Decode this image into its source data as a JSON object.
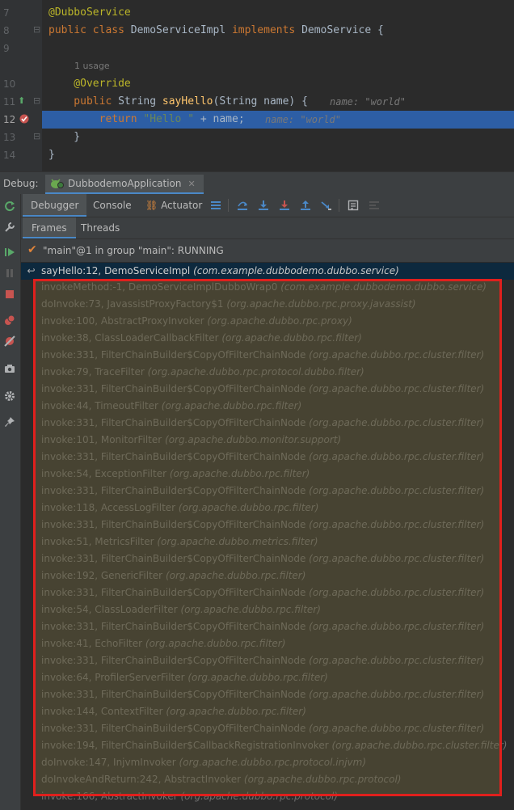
{
  "editor": {
    "lines": [
      {
        "num": "7",
        "segments": [
          {
            "cls": "ann",
            "text": "@DubboService"
          }
        ]
      },
      {
        "num": "8",
        "segments": [
          {
            "cls": "kw",
            "text": "public class "
          },
          {
            "cls": "",
            "text": "DemoServiceImpl "
          },
          {
            "cls": "kw",
            "text": "implements "
          },
          {
            "cls": "",
            "text": "DemoService {"
          }
        ]
      },
      {
        "num": "9",
        "segments": []
      },
      {
        "num": "",
        "usage": "1 usage",
        "segments": []
      },
      {
        "num": "10",
        "segments": [
          {
            "cls": "ann",
            "text": "    @Override"
          }
        ]
      },
      {
        "num": "11",
        "segments": [
          {
            "cls": "kw",
            "text": "    public "
          },
          {
            "cls": "",
            "text": "String "
          },
          {
            "cls": "fn",
            "text": "sayHello"
          },
          {
            "cls": "",
            "text": "(String name) {"
          }
        ],
        "hint": "name: \"world\""
      },
      {
        "num": "12",
        "current": true,
        "segments": [
          {
            "cls": "kw",
            "text": "        return "
          },
          {
            "cls": "str",
            "text": "\"Hello \" "
          },
          {
            "cls": "",
            "text": "+ name;"
          }
        ],
        "hint": "name: \"world\""
      },
      {
        "num": "13",
        "segments": [
          {
            "cls": "",
            "text": "    }"
          }
        ]
      },
      {
        "num": "14",
        "segments": [
          {
            "cls": "",
            "text": "}"
          }
        ]
      }
    ]
  },
  "debug": {
    "label": "Debug:",
    "run_tab": "DubbodemoApplication",
    "tabs": [
      "Debugger",
      "Console",
      "Actuator"
    ],
    "sub_tabs": [
      "Frames",
      "Threads"
    ],
    "thread_status": "\"main\"@1 in group \"main\": RUNNING"
  },
  "frames": [
    {
      "method": "sayHello:12, DemoServiceImpl ",
      "pkg": "(com.example.dubbodemo.dubbo.service)"
    },
    {
      "method": "invokeMethod:-1, DemoServiceImplDubboWrap0 ",
      "pkg": "(com.example.dubbodemo.dubbo.service)"
    },
    {
      "method": "doInvoke:73, JavassistProxyFactory$1 ",
      "pkg": "(org.apache.dubbo.rpc.proxy.javassist)"
    },
    {
      "method": "invoke:100, AbstractProxyInvoker ",
      "pkg": "(org.apache.dubbo.rpc.proxy)"
    },
    {
      "method": "invoke:38, ClassLoaderCallbackFilter ",
      "pkg": "(org.apache.dubbo.rpc.filter)"
    },
    {
      "method": "invoke:331, FilterChainBuilder$CopyOfFilterChainNode ",
      "pkg": "(org.apache.dubbo.rpc.cluster.filter)"
    },
    {
      "method": "invoke:79, TraceFilter ",
      "pkg": "(org.apache.dubbo.rpc.protocol.dubbo.filter)"
    },
    {
      "method": "invoke:331, FilterChainBuilder$CopyOfFilterChainNode ",
      "pkg": "(org.apache.dubbo.rpc.cluster.filter)"
    },
    {
      "method": "invoke:44, TimeoutFilter ",
      "pkg": "(org.apache.dubbo.rpc.filter)"
    },
    {
      "method": "invoke:331, FilterChainBuilder$CopyOfFilterChainNode ",
      "pkg": "(org.apache.dubbo.rpc.cluster.filter)"
    },
    {
      "method": "invoke:101, MonitorFilter ",
      "pkg": "(org.apache.dubbo.monitor.support)"
    },
    {
      "method": "invoke:331, FilterChainBuilder$CopyOfFilterChainNode ",
      "pkg": "(org.apache.dubbo.rpc.cluster.filter)"
    },
    {
      "method": "invoke:54, ExceptionFilter ",
      "pkg": "(org.apache.dubbo.rpc.filter)"
    },
    {
      "method": "invoke:331, FilterChainBuilder$CopyOfFilterChainNode ",
      "pkg": "(org.apache.dubbo.rpc.cluster.filter)"
    },
    {
      "method": "invoke:118, AccessLogFilter ",
      "pkg": "(org.apache.dubbo.rpc.filter)"
    },
    {
      "method": "invoke:331, FilterChainBuilder$CopyOfFilterChainNode ",
      "pkg": "(org.apache.dubbo.rpc.cluster.filter)"
    },
    {
      "method": "invoke:51, MetricsFilter ",
      "pkg": "(org.apache.dubbo.metrics.filter)"
    },
    {
      "method": "invoke:331, FilterChainBuilder$CopyOfFilterChainNode ",
      "pkg": "(org.apache.dubbo.rpc.cluster.filter)"
    },
    {
      "method": "invoke:192, GenericFilter ",
      "pkg": "(org.apache.dubbo.rpc.filter)"
    },
    {
      "method": "invoke:331, FilterChainBuilder$CopyOfFilterChainNode ",
      "pkg": "(org.apache.dubbo.rpc.cluster.filter)"
    },
    {
      "method": "invoke:54, ClassLoaderFilter ",
      "pkg": "(org.apache.dubbo.rpc.filter)"
    },
    {
      "method": "invoke:331, FilterChainBuilder$CopyOfFilterChainNode ",
      "pkg": "(org.apache.dubbo.rpc.cluster.filter)"
    },
    {
      "method": "invoke:41, EchoFilter ",
      "pkg": "(org.apache.dubbo.rpc.filter)"
    },
    {
      "method": "invoke:331, FilterChainBuilder$CopyOfFilterChainNode ",
      "pkg": "(org.apache.dubbo.rpc.cluster.filter)"
    },
    {
      "method": "invoke:64, ProfilerServerFilter ",
      "pkg": "(org.apache.dubbo.rpc.filter)"
    },
    {
      "method": "invoke:331, FilterChainBuilder$CopyOfFilterChainNode ",
      "pkg": "(org.apache.dubbo.rpc.cluster.filter)"
    },
    {
      "method": "invoke:144, ContextFilter ",
      "pkg": "(org.apache.dubbo.rpc.filter)"
    },
    {
      "method": "invoke:331, FilterChainBuilder$CopyOfFilterChainNode ",
      "pkg": "(org.apache.dubbo.rpc.cluster.filter)"
    },
    {
      "method": "invoke:194, FilterChainBuilder$CallbackRegistrationInvoker ",
      "pkg": "(org.apache.dubbo.rpc.cluster.filter)"
    },
    {
      "method": "doInvoke:147, InjvmInvoker ",
      "pkg": "(org.apache.dubbo.rpc.protocol.injvm)"
    },
    {
      "method": "doInvokeAndReturn:242, AbstractInvoker ",
      "pkg": "(org.apache.dubbo.rpc.protocol)"
    },
    {
      "method": "invoke:166, AbstractInvoker ",
      "pkg": "(org.apache.dubbo.rpc.protocol)"
    }
  ],
  "colors": {
    "highlight": "#2d5ea5",
    "selection": "#0d293e",
    "annotation_box": "#e0201d"
  }
}
